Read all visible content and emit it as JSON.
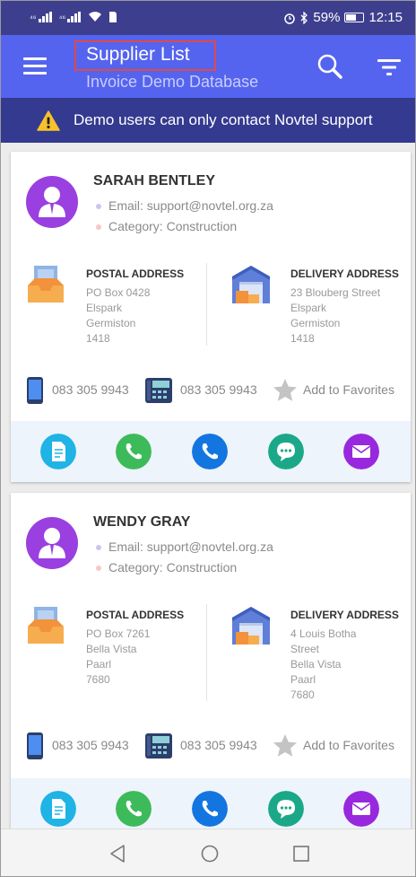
{
  "status_bar": {
    "signal_1": "⁴⁶",
    "signal_2": "⁴⁶",
    "battery": "59%",
    "time": "12:15"
  },
  "app_bar": {
    "title": "Supplier List",
    "subtitle": "Invoice Demo Database"
  },
  "banner": {
    "text": "Demo users can only contact Novtel support"
  },
  "icons": {
    "menu": "menu-icon",
    "search": "search-icon",
    "filter": "filter-icon",
    "warning": "warning-icon",
    "avatar": "person-avatar-icon",
    "postal": "inbox-tray-icon",
    "delivery": "warehouse-icon",
    "mobile": "mobile-phone-icon",
    "landline": "desk-phone-icon",
    "favorite": "star-icon",
    "actions": [
      "document-icon",
      "phone-icon",
      "call-icon",
      "chat-icon",
      "mail-icon"
    ]
  },
  "colors": {
    "app_bar": "#5564ef",
    "banner": "#343a8f",
    "avatar": "#9a3fe0",
    "email_dot": "#c7c7f5",
    "category_dot": "#f5c7c7"
  },
  "suppliers": [
    {
      "name": "SARAH BENTLEY",
      "email": "Email: support@novtel.org.za",
      "category": "Category: Construction",
      "postal_title": "POSTAL ADDRESS",
      "postal_lines": [
        "PO Box 0428",
        "Elspark",
        "Germiston",
        "1418"
      ],
      "delivery_title": "DELIVERY ADDRESS",
      "delivery_lines": [
        "23 Blouberg Street",
        "Elspark",
        "Germiston",
        "1418"
      ],
      "mobile": "083 305 9943",
      "landline": "083 305 9943",
      "favorite": "Add to Favorites"
    },
    {
      "name": "WENDY GRAY",
      "email": "Email: support@novtel.org.za",
      "category": "Category: Construction",
      "postal_title": "POSTAL ADDRESS",
      "postal_lines": [
        "PO Box 7261",
        "Bella Vista",
        "Paarl",
        "7680"
      ],
      "delivery_title": "DELIVERY ADDRESS",
      "delivery_lines": [
        "4 Louis Botha",
        "Street",
        "Bella Vista",
        "Paarl",
        "7680"
      ],
      "mobile": "083 305 9943",
      "landline": "083 305 9943",
      "favorite": "Add to Favorites"
    }
  ]
}
